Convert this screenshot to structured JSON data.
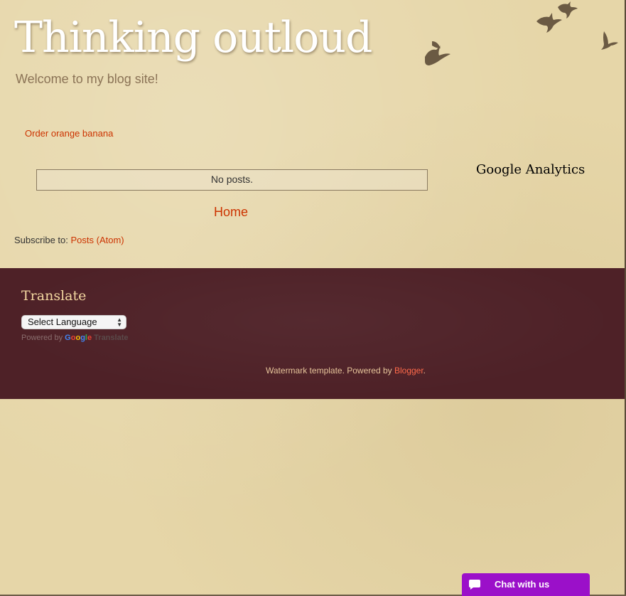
{
  "header": {
    "title": "Thinking outloud",
    "description": "Welcome to my blog site!"
  },
  "main": {
    "top_link": "Order orange banana",
    "no_posts": "No posts.",
    "home_link": "Home",
    "subscribe_prefix": "Subscribe to: ",
    "subscribe_link": "Posts (Atom)"
  },
  "sidebar": {
    "title": "Google Analytics"
  },
  "footer": {
    "translate_title": "Translate",
    "language_select": "Select Language",
    "powered_by": "Powered by ",
    "google_letters": [
      "G",
      "o",
      "o",
      "g",
      "l",
      "e"
    ],
    "translate_word": "Translate",
    "attribution_text": "Watermark template. Powered by ",
    "attribution_link": "Blogger",
    "attribution_suffix": "."
  },
  "chat": {
    "label": "Chat with us",
    "icon": "chat-bubble-icon"
  },
  "colors": {
    "background": "#e6d6a8",
    "footer_background": "#4e2127",
    "link": "#cc3300",
    "chat_button": "#9b10c9",
    "google_blue": "#4285f4",
    "google_red": "#ea4335",
    "google_yellow": "#fbbc05",
    "google_green": "#34a853"
  }
}
